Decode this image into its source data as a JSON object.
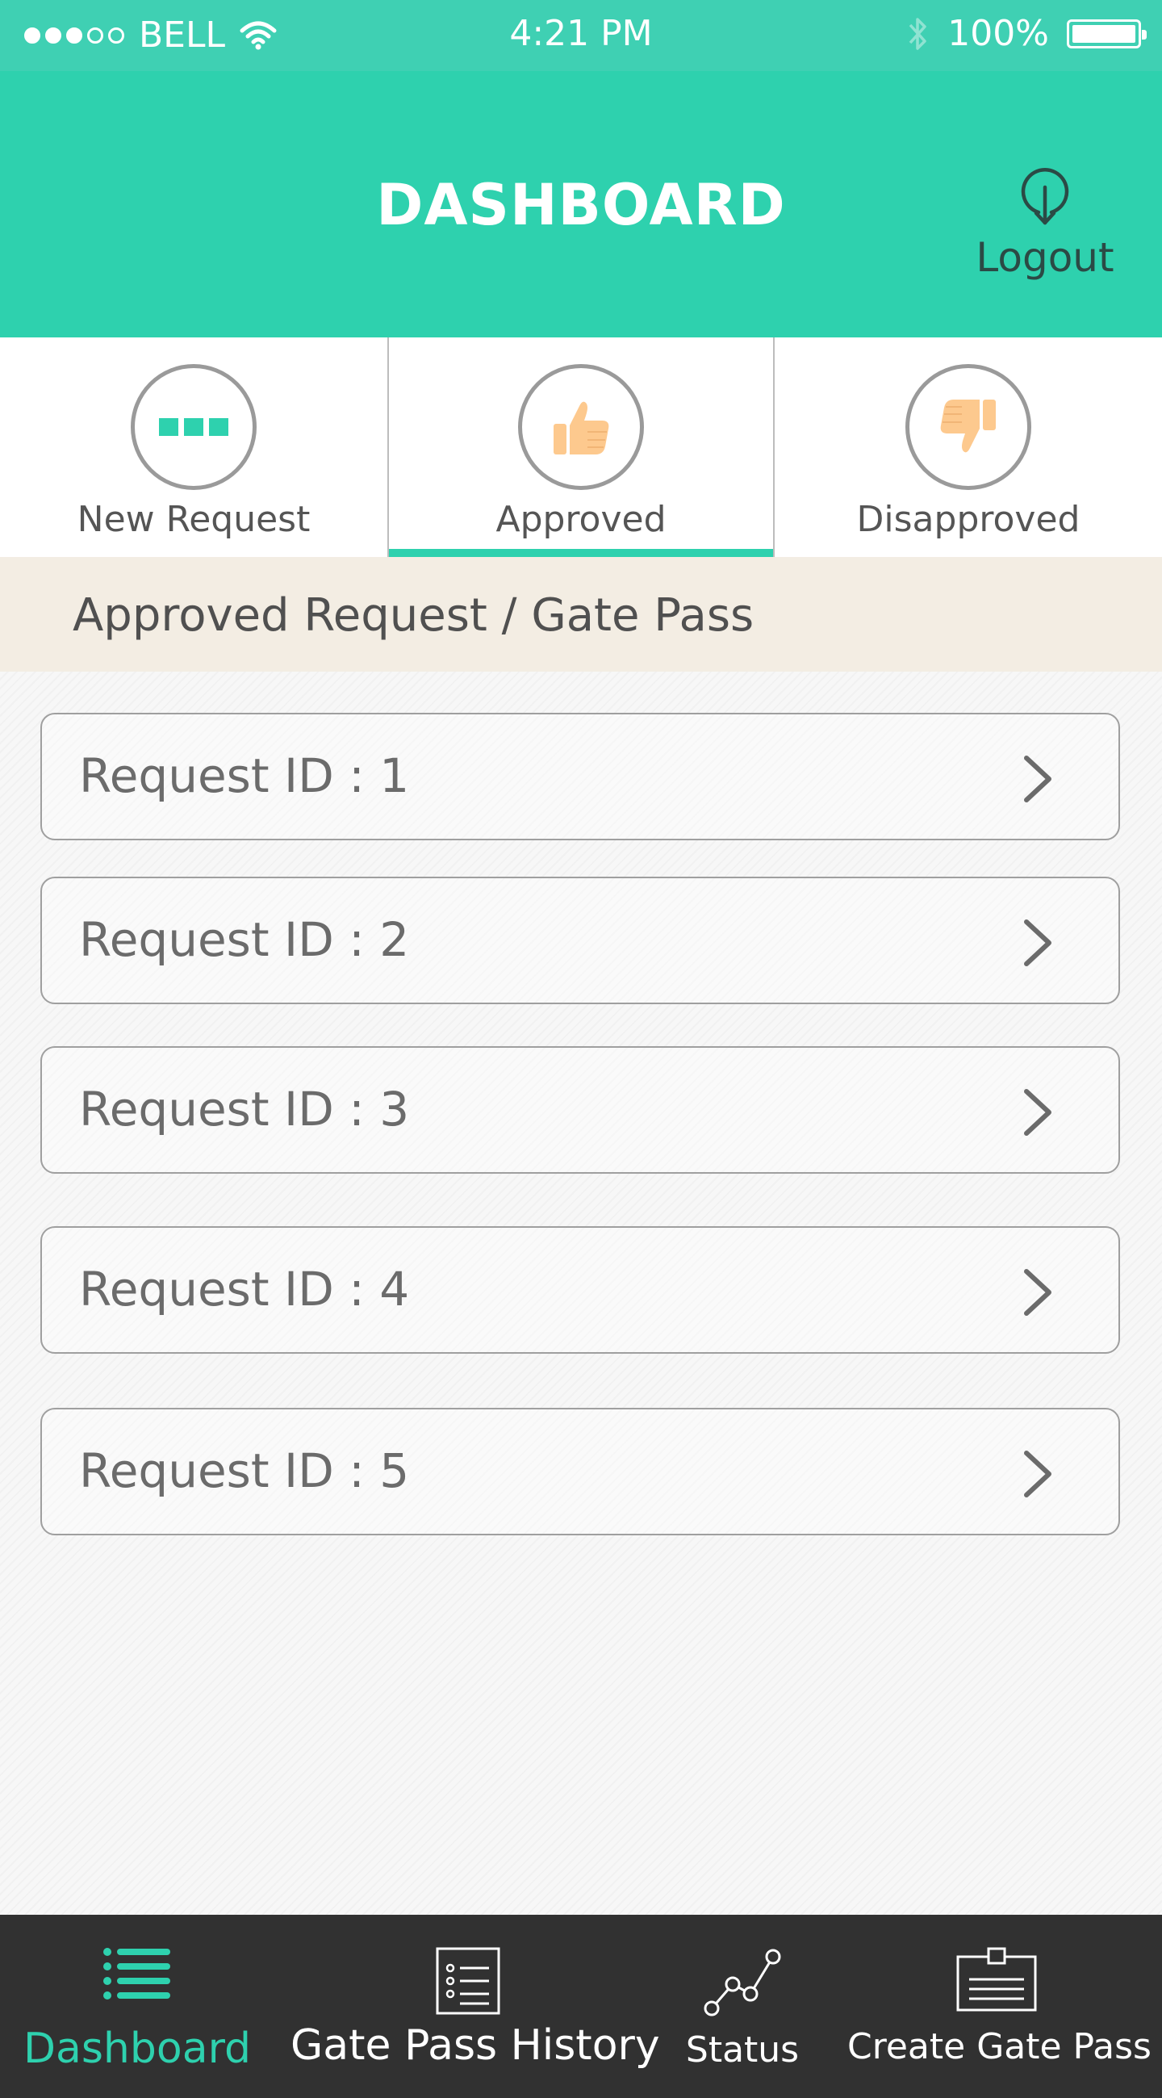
{
  "status_bar": {
    "carrier": "BELL",
    "time": "4:21 PM",
    "battery": "100%"
  },
  "header": {
    "title": "DASHBOARD",
    "logout_label": "Logout"
  },
  "tabs": [
    {
      "label": "New Request",
      "icon": "dots-icon"
    },
    {
      "label": "Approved",
      "icon": "thumbs-up-icon",
      "active": true
    },
    {
      "label": "Disapproved",
      "icon": "thumbs-down-icon"
    }
  ],
  "section": {
    "title": "Approved Request / Gate Pass"
  },
  "requests": [
    {
      "label": "Request ID : 1"
    },
    {
      "label": "Request ID : 2"
    },
    {
      "label": "Request ID : 3"
    },
    {
      "label": "Request ID : 4"
    },
    {
      "label": "Request ID : 5"
    }
  ],
  "bottom_nav": [
    {
      "label": "Dashboard",
      "icon": "list-icon",
      "active": true
    },
    {
      "label": "Gate Pass History",
      "icon": "document-list-icon"
    },
    {
      "label": "Status",
      "icon": "line-graph-icon"
    },
    {
      "label": "Create Gate Pass",
      "icon": "id-card-icon"
    }
  ],
  "colors": {
    "accent": "#2ed1ae",
    "status_bar": "#3fd0b3",
    "nav_bg": "#313131",
    "banner_bg": "#f3ede3",
    "thumb": "#fdc98e"
  }
}
